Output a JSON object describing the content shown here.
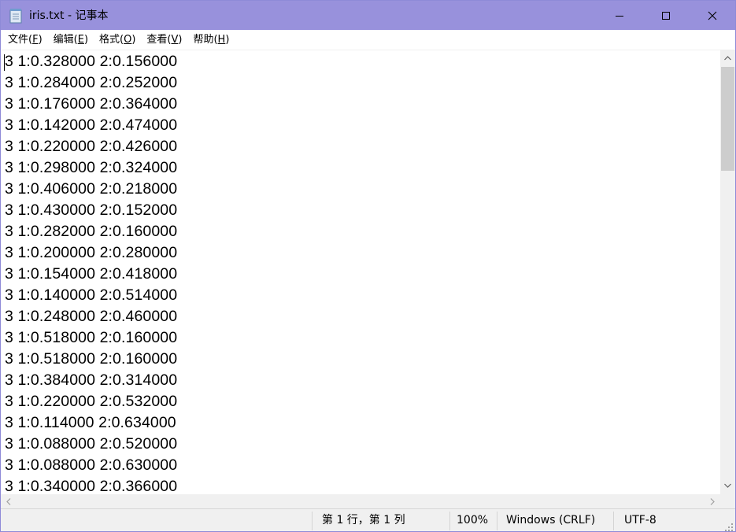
{
  "window": {
    "title": "iris.txt - 记事本",
    "colors": {
      "titlebar": "#9891dc",
      "chrome": "#f0f0f0"
    }
  },
  "menu": [
    {
      "label": "文件(",
      "key": "F",
      "suffix": ")"
    },
    {
      "label": "编辑(",
      "key": "E",
      "suffix": ")"
    },
    {
      "label": "格式(",
      "key": "O",
      "suffix": ")"
    },
    {
      "label": "查看(",
      "key": "V",
      "suffix": ")"
    },
    {
      "label": "帮助(",
      "key": "H",
      "suffix": ")"
    }
  ],
  "editor": {
    "lines": [
      "3 1:0.328000 2:0.156000",
      "3 1:0.284000 2:0.252000",
      "3 1:0.176000 2:0.364000",
      "3 1:0.142000 2:0.474000",
      "3 1:0.220000 2:0.426000",
      "3 1:0.298000 2:0.324000",
      "3 1:0.406000 2:0.218000",
      "3 1:0.430000 2:0.152000",
      "3 1:0.282000 2:0.160000",
      "3 1:0.200000 2:0.280000",
      "3 1:0.154000 2:0.418000",
      "3 1:0.140000 2:0.514000",
      "3 1:0.248000 2:0.460000",
      "3 1:0.518000 2:0.160000",
      "3 1:0.518000 2:0.160000",
      "3 1:0.384000 2:0.314000",
      "3 1:0.220000 2:0.532000",
      "3 1:0.114000 2:0.634000",
      "3 1:0.088000 2:0.520000",
      "3 1:0.088000 2:0.630000",
      "3 1:0.340000 2:0.366000"
    ]
  },
  "status": {
    "position": "第 1 行，第 1 列",
    "zoom": "100%",
    "line_ending": "Windows (CRLF)",
    "encoding": "UTF-8"
  },
  "icons": {
    "app": "notepad-icon",
    "minimize": "minimize-icon",
    "maximize": "maximize-icon",
    "close": "close-icon"
  }
}
